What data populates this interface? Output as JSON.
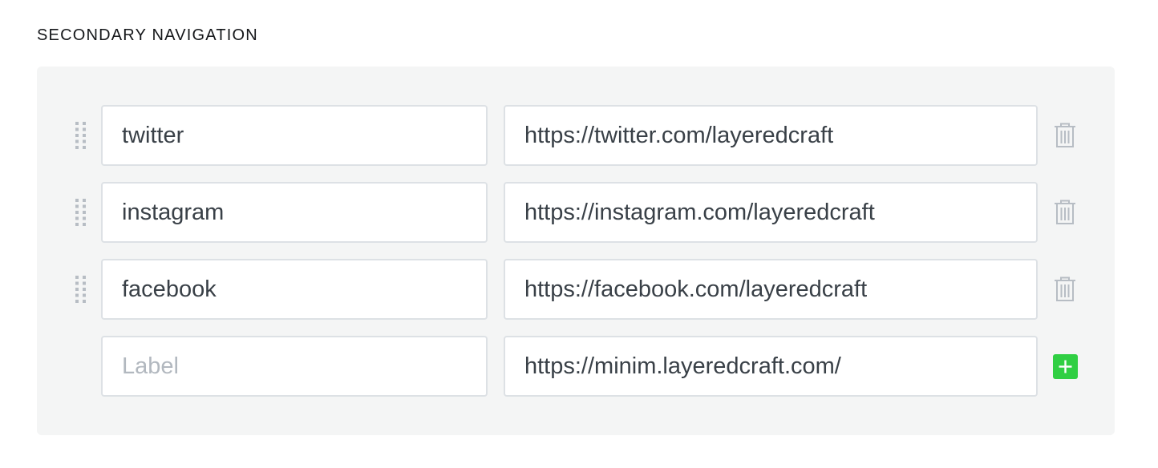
{
  "section": {
    "title": "SECONDARY NAVIGATION"
  },
  "nav_items": [
    {
      "label": "twitter",
      "url": "https://twitter.com/layeredcraft"
    },
    {
      "label": "instagram",
      "url": "https://instagram.com/layeredcraft"
    },
    {
      "label": "facebook",
      "url": "https://facebook.com/layeredcraft"
    }
  ],
  "new_item": {
    "label": "",
    "label_placeholder": "Label",
    "url": "https://minim.layeredcraft.com/"
  },
  "icons": {
    "drag": "drag-handle-icon",
    "delete": "trash-icon",
    "add": "plus-icon"
  },
  "colors": {
    "accent": "#30cf43",
    "panel_bg": "#f4f5f5",
    "border": "#dde1e5",
    "icon": "#b7bdc4"
  }
}
